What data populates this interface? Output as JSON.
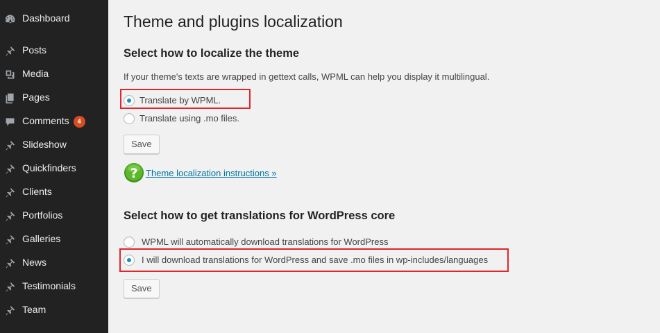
{
  "sidebar": {
    "items": [
      {
        "label": "Dashboard",
        "icon": "dashboard-icon"
      },
      {
        "label": "Posts",
        "icon": "pin-icon"
      },
      {
        "label": "Media",
        "icon": "media-icon"
      },
      {
        "label": "Pages",
        "icon": "pages-icon"
      },
      {
        "label": "Comments",
        "icon": "comment-icon",
        "badge": "4"
      },
      {
        "label": "Slideshow",
        "icon": "pin-icon"
      },
      {
        "label": "Quickfinders",
        "icon": "pin-icon"
      },
      {
        "label": "Clients",
        "icon": "pin-icon"
      },
      {
        "label": "Portfolios",
        "icon": "pin-icon"
      },
      {
        "label": "Galleries",
        "icon": "pin-icon"
      },
      {
        "label": "News",
        "icon": "pin-icon"
      },
      {
        "label": "Testimonials",
        "icon": "pin-icon"
      },
      {
        "label": "Team",
        "icon": "pin-icon"
      }
    ]
  },
  "main": {
    "title": "Theme and plugins localization",
    "theme_section": {
      "heading": "Select how to localize the theme",
      "description": "If your theme's texts are wrapped in gettext calls, WPML can help you display it multilingual.",
      "options": [
        {
          "label": "Translate by WPML.",
          "checked": true
        },
        {
          "label": "Translate using .mo files.",
          "checked": false
        }
      ],
      "save_label": "Save",
      "help_link": "Theme localization instructions »"
    },
    "core_section": {
      "heading": "Select how to get translations for WordPress core",
      "options": [
        {
          "label": "WPML will automatically download translations for WordPress",
          "checked": false
        },
        {
          "label": "I will download translations for WordPress and save .mo files in wp-includes/languages",
          "checked": true
        }
      ],
      "save_label": "Save"
    }
  },
  "colors": {
    "sidebar_bg": "#222222",
    "highlight": "#e0262b",
    "link": "#0074a2",
    "badge": "#d54e21",
    "help_icon": "#5cb82a"
  }
}
